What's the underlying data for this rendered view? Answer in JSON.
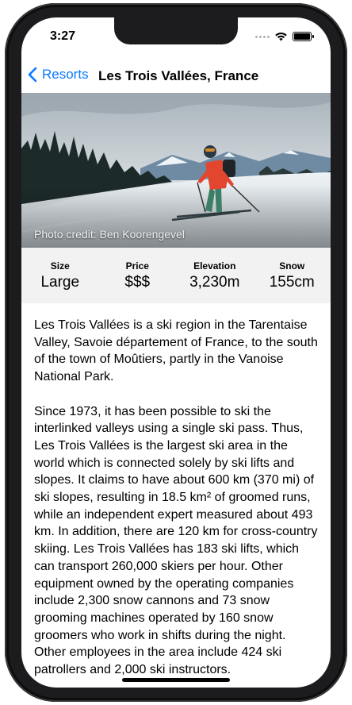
{
  "status_bar": {
    "time": "3:27"
  },
  "nav": {
    "back_label": "Resorts",
    "title": "Les Trois Vallées, France"
  },
  "hero": {
    "photo_credit": "Photo credit: Ben Koorengevel"
  },
  "stats": [
    {
      "label": "Size",
      "value": "Large"
    },
    {
      "label": "Price",
      "value": "$$$"
    },
    {
      "label": "Elevation",
      "value": "3,230m"
    },
    {
      "label": "Snow",
      "value": "155cm"
    }
  ],
  "description": {
    "paragraph_1": "Les Trois Vallées is a ski region in the Tarentaise Valley, Savoie département of France, to the south of the town of Moûtiers, partly in the Vanoise National Park.",
    "paragraph_2": "Since 1973, it has been possible to ski the interlinked valleys using a single ski pass. Thus, Les Trois Vallées is the largest ski area in the world which is connected solely by ski lifts and slopes. It claims to have about 600 km (370 mi) of ski slopes, resulting in 18.5 km² of groomed runs, while an independent expert measured about 493 km. In addition, there are 120 km for cross-country skiing. Les Trois Vallées has 183 ski lifts, which can transport 260,000 skiers per hour. Other equipment owned by the operating companies include 2,300 snow cannons and 73 snow grooming machines operated by 160 snow groomers who work in shifts during the night. Other employees in the area include 424 ski patrollers and 2,000 ski instructors."
  }
}
